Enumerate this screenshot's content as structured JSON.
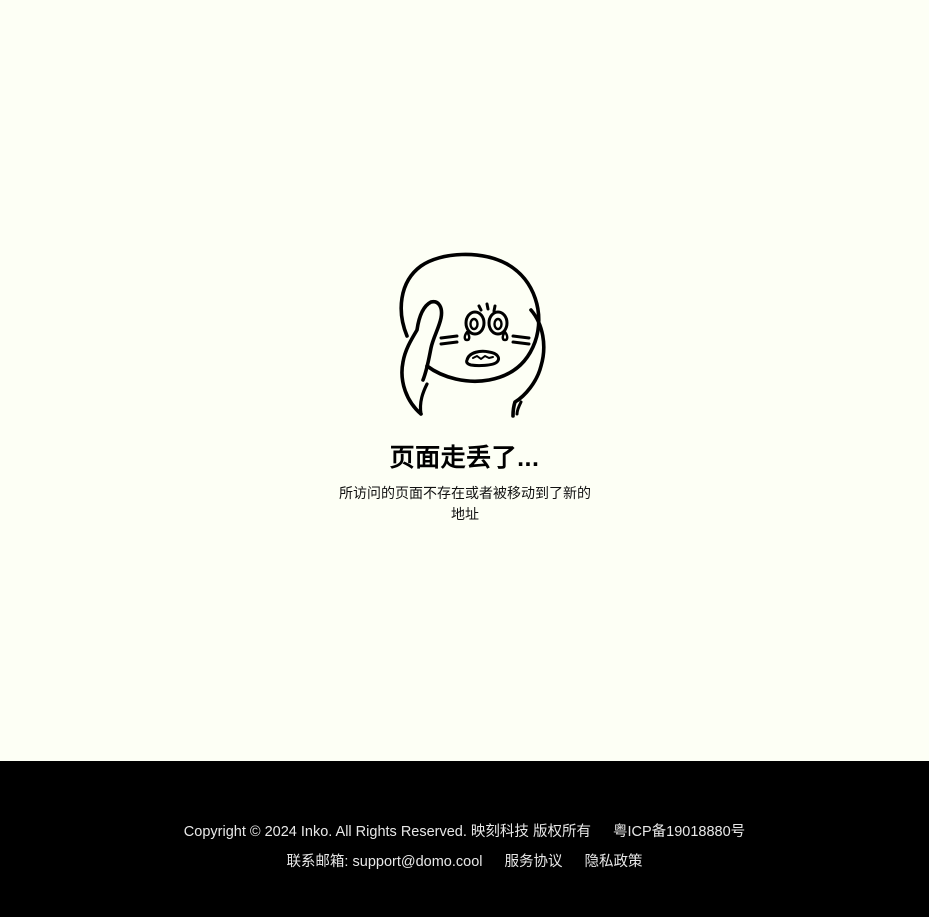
{
  "error": {
    "title": "页面走丢了...",
    "message": "所访问的页面不存在或者被移动到了新的地址"
  },
  "footer": {
    "copyright": "Copyright © 2024 Inko. All Rights Reserved. 映刻科技 版权所有",
    "icp": "粤ICP备19018880号",
    "contact_label": "联系邮箱:",
    "contact_email": "support@domo.cool",
    "terms": "服务协议",
    "privacy": "隐私政策"
  },
  "colors": {
    "page_background": "#fdfff5",
    "footer_background": "#000000",
    "footer_text": "#e8e8e8"
  },
  "icons": {
    "illustration": "crying-character-illustration"
  }
}
